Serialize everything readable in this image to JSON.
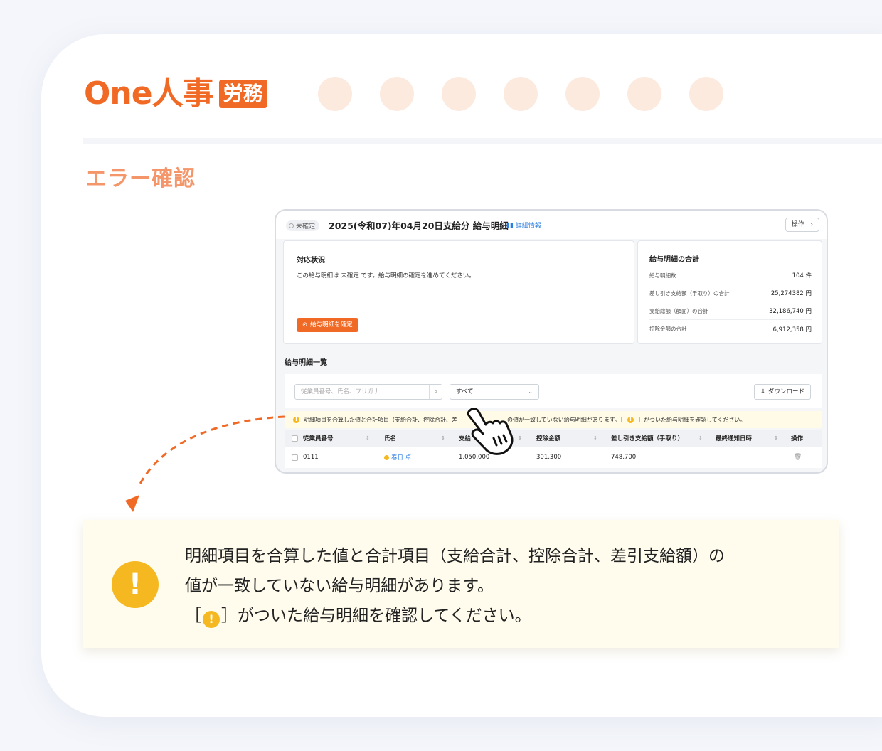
{
  "brand": {
    "name": "One人事",
    "badge": "労務"
  },
  "section_title": "エラー確認",
  "screen": {
    "status_chip": "未確定",
    "title": "2025(令和07)年04月20日支給分 給与明細",
    "detail_link": "詳細情報",
    "op_button": "操作",
    "status_panel": {
      "title": "対応状況",
      "text": "この給与明細は 未確定 です。給与明細の確定を進めてください。",
      "confirm_button": "給与明細を確定"
    },
    "summary_panel": {
      "title": "給与明細の合計",
      "rows": [
        {
          "label": "給与明細数",
          "value": "104 件"
        },
        {
          "label": "差し引き支給額（手取り）の合計",
          "value": "25,274382 円"
        },
        {
          "label": "支給総額（額面）の合計",
          "value": "32,186,740 円"
        },
        {
          "label": "控除金額の合計",
          "value": "6,912,358 円"
        }
      ]
    },
    "list_title": "給与明細一覧",
    "search_placeholder": "従業員番号、氏名、フリガナ",
    "select_value": "すべて",
    "download_button": "ダウンロード",
    "warning_bar": {
      "part1": "明細項目を合算した値と合計項目（支給合計、控除合計、差",
      "part2": "の値が一致していない給与明細があります。［",
      "part3": "］がついた給与明細を確認してください。"
    },
    "table": {
      "headers": [
        "従業員番号",
        "氏名",
        "支給",
        "控除金額",
        "差し引き支給額（手取り）",
        "最終通知日時",
        "操作"
      ],
      "rows": [
        {
          "id": "0111",
          "name": "春日 卓",
          "pay": "1,050,000",
          "deduction": "301,300",
          "net": "748,700",
          "notified": ""
        }
      ]
    }
  },
  "callout": {
    "line1": "明細項目を合算した値と合計項目（支給合計、控除合計、差引支給額）の",
    "line2": "値が一致していない給与明細があります。",
    "line3_pre": "［",
    "line3_post": "］がついた給与明細を確認してください。"
  },
  "colors": {
    "accent": "#f16a25",
    "warning": "#f5b820",
    "link": "#2a7de1"
  }
}
